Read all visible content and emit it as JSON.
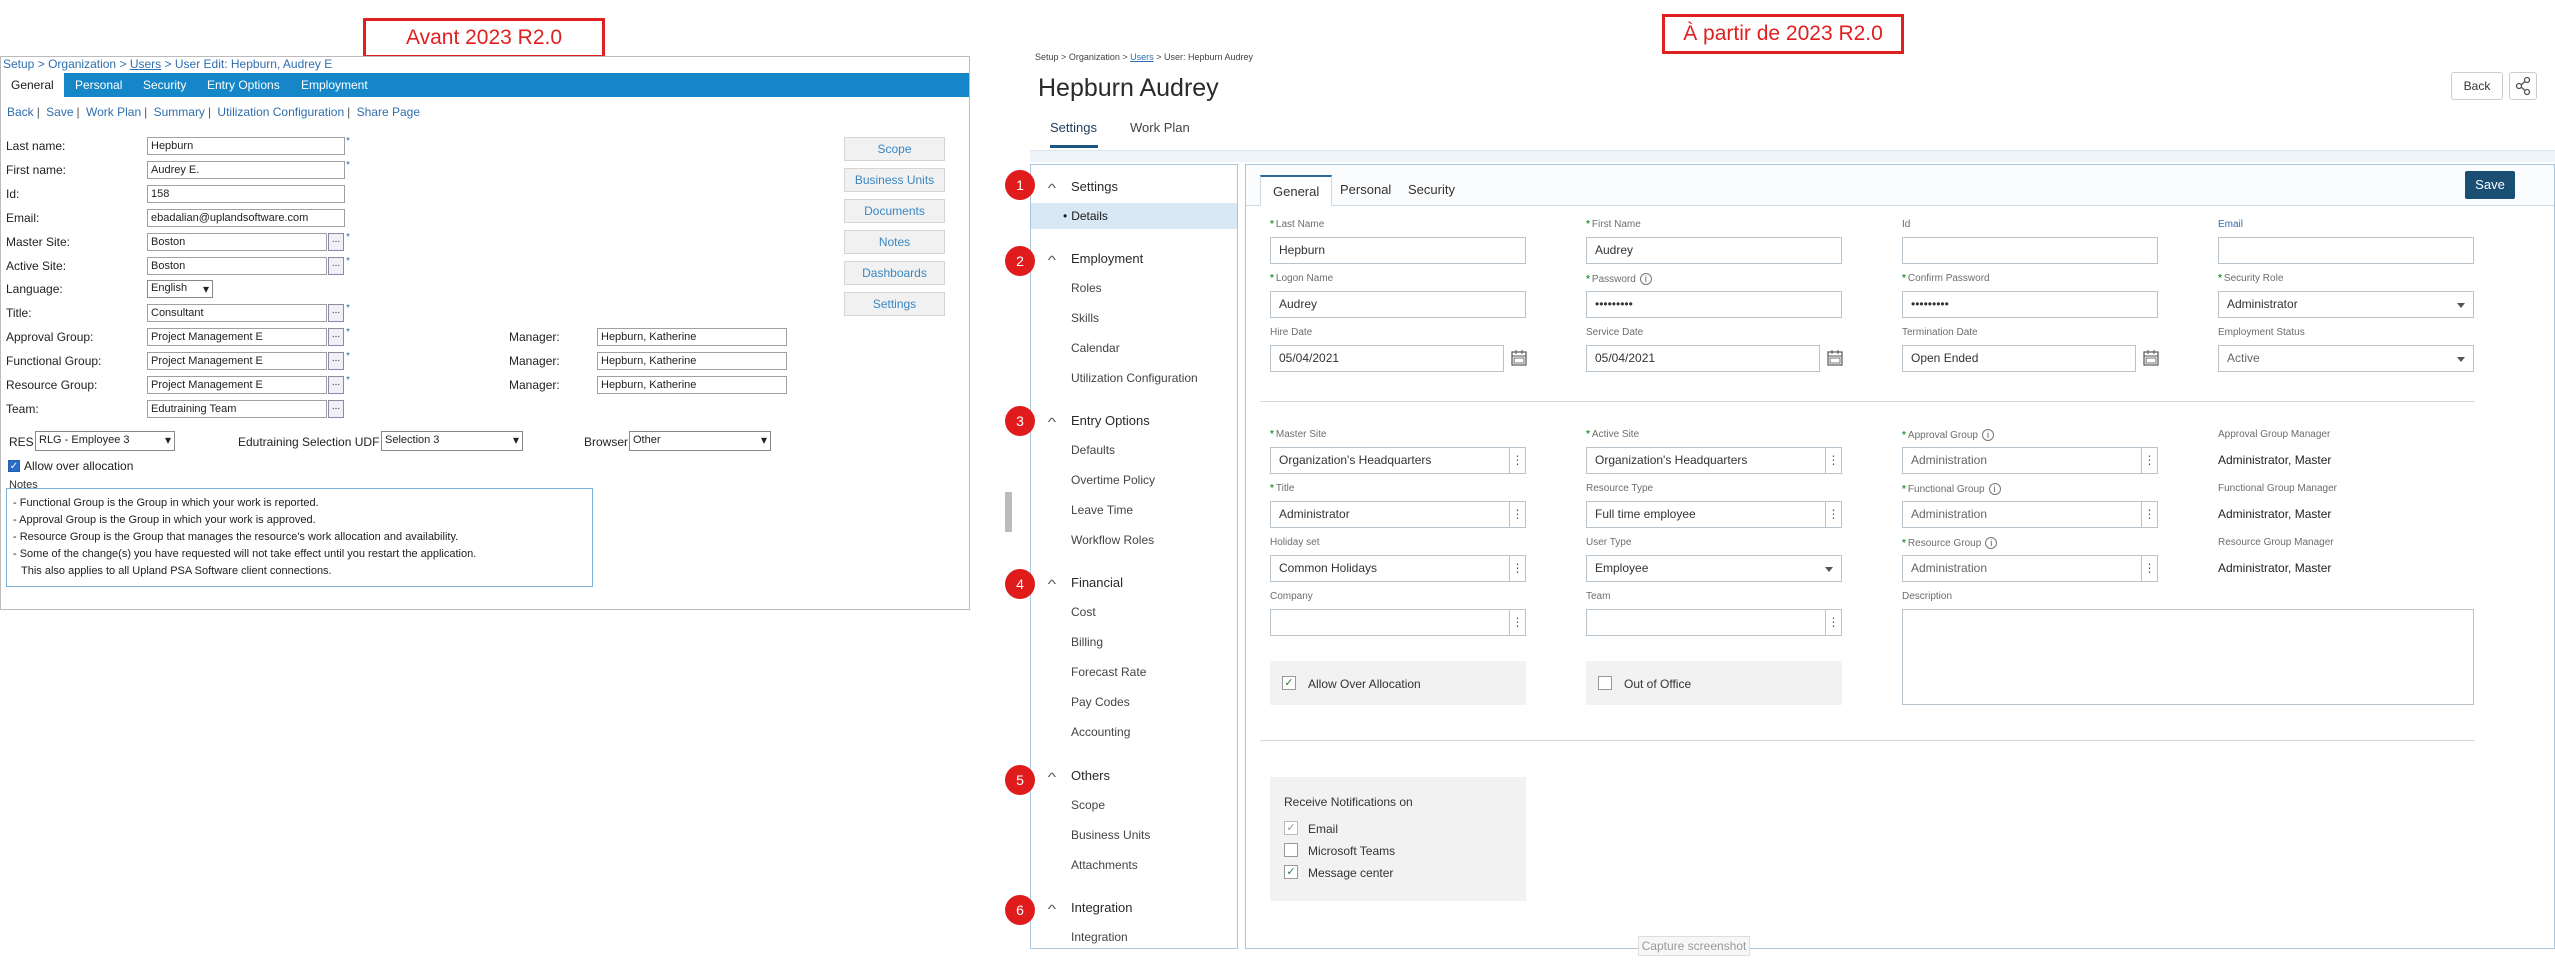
{
  "callouts": {
    "left": "Avant 2023 R2.0",
    "right": "À partir de 2023 R2.0"
  },
  "old": {
    "breadcrumb": {
      "setup": "Setup",
      "org": "Organization",
      "users": "Users",
      "current": "User Edit: Hepburn, Audrey E",
      "sep": ">"
    },
    "tabs": [
      "General",
      "Personal",
      "Security",
      "Entry Options",
      "Employment"
    ],
    "links": [
      "Back",
      "Save",
      "Work Plan",
      "Summary",
      "Utilization Configuration",
      "Share Page"
    ],
    "link_sep": "|",
    "side_buttons": [
      "Scope",
      "Business Units",
      "Documents",
      "Notes",
      "Dashboards",
      "Settings"
    ],
    "fields": {
      "last_name": {
        "label": "Last name:",
        "value": "Hepburn"
      },
      "first_name": {
        "label": "First name:",
        "value": "Audrey E."
      },
      "id": {
        "label": "Id:",
        "value": "158"
      },
      "email": {
        "label": "Email:",
        "value": "ebadalian@uplandsoftware.com"
      },
      "master_site": {
        "label": "Master Site:",
        "value": "Boston"
      },
      "active_site": {
        "label": "Active Site:",
        "value": "Boston"
      },
      "language": {
        "label": "Language:",
        "value": "English"
      },
      "title": {
        "label": "Title:",
        "value": "Consultant"
      },
      "approval_group": {
        "label": "Approval Group:",
        "value": "Project Management E"
      },
      "functional_group": {
        "label": "Functional Group:",
        "value": "Project Management E"
      },
      "resource_group": {
        "label": "Resource Group:",
        "value": "Project Management E"
      },
      "team": {
        "label": "Team:",
        "value": "Edutraining Team"
      }
    },
    "manager_label": "Manager:",
    "managers": [
      "Hepburn, Katherine",
      "Hepburn, Katherine",
      "Hepburn, Katherine"
    ],
    "ellipsis": "...",
    "required_mark": "*",
    "res": {
      "label": "RES",
      "value": "RLG - Employee 3"
    },
    "udf": {
      "label": "Edutraining Selection UDF",
      "value": "Selection 3"
    },
    "browser": {
      "label": "Browser",
      "value": "Other"
    },
    "allow_over_allocation": "Allow over allocation",
    "notes_title": "Notes",
    "notes": [
      "- Functional Group is the Group in which your work is reported.",
      "- Approval Group is the Group in which your work is approved.",
      "- Resource Group is the Group that manages the resource's work allocation and availability.",
      "- Some of the change(s) you have requested will not take effect until you restart the application.",
      "  This also applies to all Upland PSA Software client connections."
    ]
  },
  "new": {
    "breadcrumb": {
      "setup": "Setup",
      "org": "Organization",
      "users": "Users",
      "current": "User: Hepburn Audrey",
      "sep": ">"
    },
    "title": "Hepburn Audrey",
    "back": "Back",
    "main_tabs": [
      "Settings",
      "Work Plan"
    ],
    "sidebar": [
      {
        "num": "1",
        "group": "Settings",
        "items": [
          "Details"
        ]
      },
      {
        "num": "2",
        "group": "Employment",
        "items": [
          "Roles",
          "Skills",
          "Calendar",
          "Utilization Configuration"
        ]
      },
      {
        "num": "3",
        "group": "Entry Options",
        "items": [
          "Defaults",
          "Overtime Policy",
          "Leave Time",
          "Workflow Roles"
        ]
      },
      {
        "num": "4",
        "group": "Financial",
        "items": [
          "Cost",
          "Billing",
          "Forecast Rate",
          "Pay Codes",
          "Accounting"
        ]
      },
      {
        "num": "5",
        "group": "Others",
        "items": [
          "Scope",
          "Business Units",
          "Attachments"
        ]
      },
      {
        "num": "6",
        "group": "Integration",
        "items": [
          "Integration"
        ]
      }
    ],
    "tabs": [
      "General",
      "Personal",
      "Security"
    ],
    "save": "Save",
    "row1": [
      {
        "label": "Last Name",
        "value": "Hepburn"
      },
      {
        "label": "First Name",
        "value": "Audrey"
      },
      {
        "label": "Id",
        "value": ""
      },
      {
        "label": "Email",
        "value": ""
      }
    ],
    "row2": [
      {
        "label": "Logon Name",
        "value": "Audrey"
      },
      {
        "label": "Password",
        "value": "•••••••••"
      },
      {
        "label": "Confirm Password",
        "value": "•••••••••"
      },
      {
        "label": "Security Role",
        "value": "Administrator"
      }
    ],
    "row3": [
      {
        "label": "Hire Date",
        "value": "05/04/2021"
      },
      {
        "label": "Service Date",
        "value": "05/04/2021"
      },
      {
        "label": "Termination Date",
        "value": "Open Ended"
      },
      {
        "label": "Employment Status",
        "value": "Active"
      }
    ],
    "row4": [
      {
        "label": "Master Site",
        "value": "Organization's Headquarters"
      },
      {
        "label": "Active Site",
        "value": "Organization's Headquarters"
      },
      {
        "label": "Approval Group",
        "value": "Administration"
      },
      {
        "label": "Approval Group Manager",
        "value": "Administrator, Master"
      }
    ],
    "row5": [
      {
        "label": "Title",
        "value": "Administrator"
      },
      {
        "label": "Resource Type",
        "value": "Full time employee"
      },
      {
        "label": "Functional Group",
        "value": "Administration"
      },
      {
        "label": "Functional Group Manager",
        "value": "Administrator, Master"
      }
    ],
    "row6": [
      {
        "label": "Holiday set",
        "value": "Common Holidays"
      },
      {
        "label": "User Type",
        "value": "Employee"
      },
      {
        "label": "Resource Group",
        "value": "Administration"
      },
      {
        "label": "Resource Group Manager",
        "value": "Administrator, Master"
      }
    ],
    "row7": [
      {
        "label": "Company",
        "value": ""
      },
      {
        "label": "Team",
        "value": ""
      },
      {
        "label": "Description",
        "value": ""
      }
    ],
    "allow_over_allocation": "Allow Over Allocation",
    "out_of_office": "Out of Office",
    "notifications": {
      "title": "Receive Notifications on",
      "items": [
        "Email",
        "Microsoft Teams",
        "Message center"
      ]
    },
    "capture": "Capture screenshot",
    "kebab": "⋮",
    "check": "✓",
    "info": "i"
  }
}
